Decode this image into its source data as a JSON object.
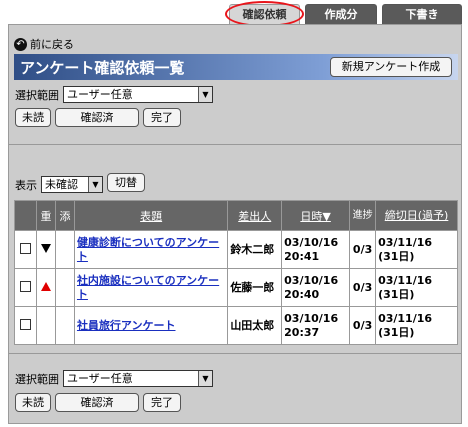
{
  "tabs": [
    {
      "label": "確認依頼"
    },
    {
      "label": "作成分"
    },
    {
      "label": "下書き"
    }
  ],
  "back_label": "前に戻る",
  "title": "アンケート確認依頼一覧",
  "new_button": "新規アンケート作成",
  "range_label": "選択範囲",
  "range_value": "ユーザー任意",
  "status_buttons": {
    "unread": "未読",
    "confirmed": "確認済",
    "done": "完了"
  },
  "display_label": "表示",
  "display_value": "未確認",
  "switch_button": "切替",
  "table": {
    "headers": {
      "priority": "重",
      "attach": "添",
      "subject": "表題",
      "sender": "差出人",
      "datetime": "日時▼",
      "progress": "進捗",
      "deadline": "締切日(過予)"
    },
    "rows": [
      {
        "priority": "down",
        "subject": "健康診断についてのアンケート",
        "sender": "鈴木二郎",
        "datetime": "03/10/16 20:41",
        "progress": "0/3",
        "deadline": "03/11/16 (31日)"
      },
      {
        "priority": "up",
        "subject": "社内施設についてのアンケート",
        "sender": "佐藤一郎",
        "datetime": "03/10/16 20:40",
        "progress": "0/3",
        "deadline": "03/11/16 (31日)"
      },
      {
        "priority": "",
        "subject": "社員旅行アンケート",
        "sender": "山田太郎",
        "datetime": "03/10/16 20:37",
        "progress": "0/3",
        "deadline": "03/11/16 (31日)"
      }
    ]
  },
  "colors": {
    "highlight_ring": "#e8151b",
    "link": "#1a2fbf",
    "priority_up": "#e00000"
  }
}
